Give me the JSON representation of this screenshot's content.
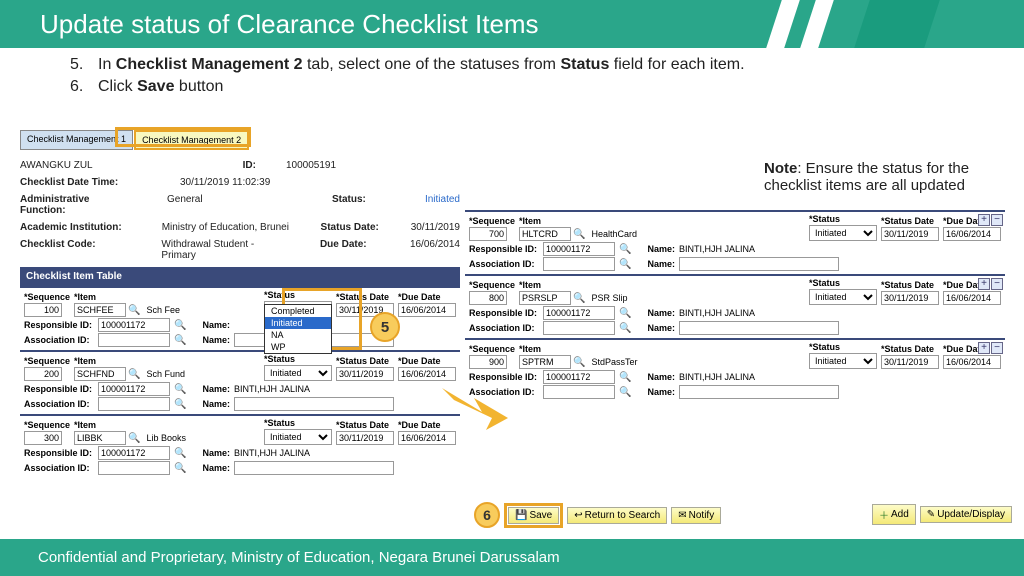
{
  "title": "Update status of Clearance Checklist Items",
  "instructions": [
    {
      "n": "5.",
      "pre": "In ",
      "b1": "Checklist Management 2",
      "mid": " tab, select one of the statuses from ",
      "b2": "Status",
      "post": " field for each item."
    },
    {
      "n": "6.",
      "pre": "Click ",
      "b1": "Save",
      "mid": " button",
      "b2": "",
      "post": ""
    }
  ],
  "note": {
    "b": "Note",
    "rest": ": Ensure the status for the checklist items are all updated"
  },
  "tabs": [
    "Checklist Management 1",
    "Checklist Management 2"
  ],
  "header": {
    "name": "AWANGKU ZUL",
    "id_lbl": "ID:",
    "id": "100005191",
    "rows": [
      {
        "l": "Checklist Date Time:",
        "v": "30/11/2019 11:02:39",
        "l2": "",
        "v2": ""
      },
      {
        "l": "Administrative Function:",
        "v": "General",
        "l2": "Status:",
        "v2": "Initiated"
      },
      {
        "l": "Academic Institution:",
        "v": "Ministry of Education, Brunei",
        "l2": "Status Date:",
        "v2": "30/11/2019"
      },
      {
        "l": "Checklist Code:",
        "v": "Withdrawal Student - Primary",
        "l2": "Due Date:",
        "v2": "16/06/2014"
      }
    ]
  },
  "table_title": "Checklist Item Table",
  "cols": {
    "seq": "*Sequence",
    "item": "*Item",
    "status": "*Status",
    "sdate": "*Status Date",
    "ddate": "*Due Date",
    "resp": "Responsible ID:",
    "assoc": "Association ID:",
    "name": "Name:"
  },
  "status_options": [
    "Completed",
    "Initiated",
    "NA",
    "WP"
  ],
  "left_items": [
    {
      "seq": "100",
      "item": "SCHFEE",
      "desc": "Sch Fee",
      "status": "Initiated",
      "sdate": "30/11/2019",
      "ddate": "16/06/2014",
      "resp": "100001172",
      "name": "",
      "open": true
    },
    {
      "seq": "200",
      "item": "SCHFND",
      "desc": "Sch Fund",
      "status": "Initiated",
      "sdate": "30/11/2019",
      "ddate": "16/06/2014",
      "resp": "100001172",
      "name": "BINTI,HJH JALINA",
      "open": false
    },
    {
      "seq": "300",
      "item": "LIBBK",
      "desc": "Lib Books",
      "status": "Initiated",
      "sdate": "30/11/2019",
      "ddate": "16/06/2014",
      "resp": "100001172",
      "name": "BINTI,HJH JALINA",
      "open": false
    }
  ],
  "right_items": [
    {
      "seq": "700",
      "item": "HLTCRD",
      "desc": "HealthCard",
      "status": "Initiated",
      "sdate": "30/11/2019",
      "ddate": "16/06/2014",
      "resp": "100001172",
      "name": "BINTI,HJH JALINA"
    },
    {
      "seq": "800",
      "item": "PSRSLP",
      "desc": "PSR Slip",
      "status": "Initiated",
      "sdate": "30/11/2019",
      "ddate": "16/06/2014",
      "resp": "100001172",
      "name": "BINTI,HJH JALINA"
    },
    {
      "seq": "900",
      "item": "SPTRM",
      "desc": "StdPassTer",
      "status": "Initiated",
      "sdate": "30/11/2019",
      "ddate": "16/06/2014",
      "resp": "100001172",
      "name": "BINTI,HJH JALINA"
    }
  ],
  "buttons": {
    "save": "Save",
    "return": "Return to Search",
    "notify": "Notify",
    "add": "Add",
    "update": "Update/Display"
  },
  "callouts": {
    "c5": "5",
    "c6": "6"
  },
  "footer": "Confidential and Proprietary, Ministry of Education, Negara Brunei Darussalam"
}
